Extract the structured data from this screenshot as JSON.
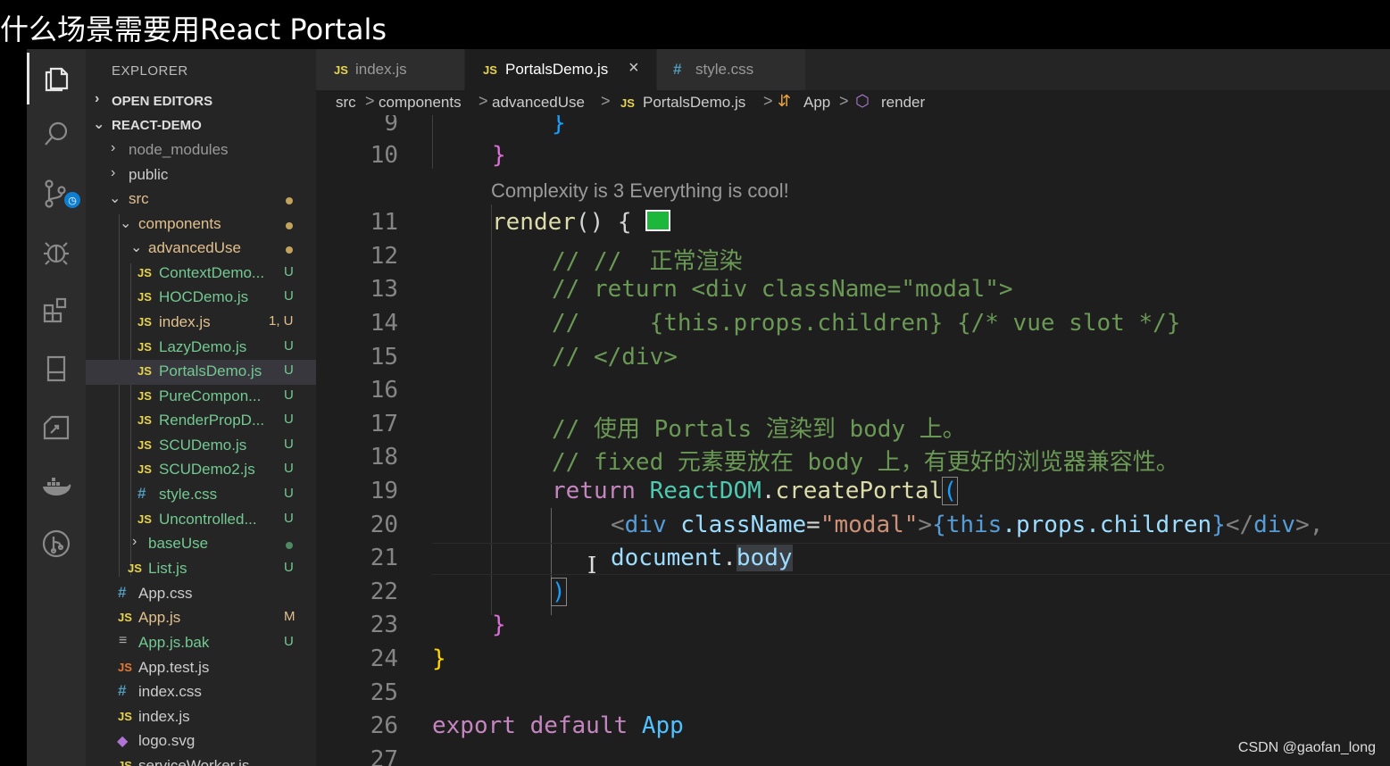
{
  "page_title": "什么场景需要用React Portals",
  "watermark": "CSDN @gaofan_long",
  "activity_bar": {
    "icons": [
      "explorer-icon",
      "search-icon",
      "source-control-icon",
      "debug-icon",
      "extensions-icon",
      "bookmark-icon",
      "remote-explorer-icon",
      "docker-icon",
      "git-graph-icon"
    ],
    "colors": {
      "background": "#2c2c2c",
      "badge": "#0e7ed3"
    }
  },
  "explorer": {
    "title": "EXPLORER",
    "sections": {
      "open_editors": "OPEN EDITORS",
      "project": "REACT-DEMO"
    },
    "items": [
      {
        "label": "node_modules",
        "type": "folder",
        "status": ""
      },
      {
        "label": "public",
        "type": "folder",
        "status": ""
      },
      {
        "label": "src",
        "type": "folder",
        "status": ""
      },
      {
        "label": "components",
        "type": "folder",
        "status": ""
      },
      {
        "label": "advancedUse",
        "type": "folder",
        "status": ""
      },
      {
        "label": "ContextDemo...",
        "type": "js",
        "status": "U"
      },
      {
        "label": "HOCDemo.js",
        "type": "js",
        "status": "U"
      },
      {
        "label": "index.js",
        "type": "js",
        "status": "1, U"
      },
      {
        "label": "LazyDemo.js",
        "type": "js",
        "status": "U"
      },
      {
        "label": "PortalsDemo.js",
        "type": "js",
        "status": "U"
      },
      {
        "label": "PureCompon...",
        "type": "js",
        "status": "U"
      },
      {
        "label": "RenderPropD...",
        "type": "js",
        "status": "U"
      },
      {
        "label": "SCUDemo.js",
        "type": "js",
        "status": "U"
      },
      {
        "label": "SCUDemo2.js",
        "type": "js",
        "status": "U"
      },
      {
        "label": "style.css",
        "type": "css",
        "status": "U"
      },
      {
        "label": "Uncontrolled...",
        "type": "js",
        "status": "U"
      },
      {
        "label": "baseUse",
        "type": "folder",
        "status": ""
      },
      {
        "label": "List.js",
        "type": "js",
        "status": "U"
      },
      {
        "label": "App.css",
        "type": "css",
        "status": ""
      },
      {
        "label": "App.js",
        "type": "js",
        "status": "M"
      },
      {
        "label": "App.js.bak",
        "type": "txt",
        "status": "U"
      },
      {
        "label": "App.test.js",
        "type": "js",
        "status": ""
      },
      {
        "label": "index.css",
        "type": "css",
        "status": ""
      },
      {
        "label": "index.js",
        "type": "js",
        "status": ""
      },
      {
        "label": "logo.svg",
        "type": "svg",
        "status": ""
      },
      {
        "label": "serviceWorker.js",
        "type": "js",
        "status": ""
      }
    ]
  },
  "tabs": [
    {
      "icon": "JS",
      "label": "index.js",
      "active": false
    },
    {
      "icon": "JS",
      "label": "PortalsDemo.js",
      "active": true,
      "close": "×"
    },
    {
      "icon": "#",
      "label": "style.css",
      "active": false
    }
  ],
  "breadcrumb": {
    "items": [
      "src",
      "components",
      "advancedUse",
      "PortalsDemo.js",
      "App",
      "render"
    ],
    "js_icon": "JS",
    "separator": ">"
  },
  "editor": {
    "codelens": "Complexity is 3 Everything is cool!",
    "line_numbers": [
      "9",
      "10",
      "11",
      "12",
      "13",
      "14",
      "15",
      "16",
      "17",
      "18",
      "19",
      "20",
      "21",
      "22",
      "23",
      "24",
      "25",
      "26",
      "27"
    ],
    "lines": {
      "l9": "}",
      "l10": "}",
      "l11_fn": "render",
      "l11_rest": "() {",
      "l12": "// //  正常渲染",
      "l13": "// return <div className=\"modal\">",
      "l14": "//     {this.props.children} {/* vue slot */}",
      "l15": "// </div>",
      "l17": "// 使用 Portals 渲染到 body 上。",
      "l18": "// fixed 元素要放在 body 上，有更好的浏览器兼容性。",
      "l19_kw": "return",
      "l19_obj": "ReactDOM",
      "l19_dot": ".",
      "l19_fn": "createPortal",
      "l19_paren": "(",
      "l20_open": "<",
      "l20_tag": "div",
      "l20_attr": "className",
      "l20_eq": "=",
      "l20_val": "\"modal\"",
      "l20_gt": ">",
      "l20_lbrace": "{",
      "l20_this": "this",
      "l20_props": ".props.children",
      "l20_rbrace": "}",
      "l20_close_open": "</",
      "l20_close_tag": "div",
      "l20_close_end": ">,",
      "l21_obj": "document",
      "l21_dot": ".",
      "l21_prop": "body",
      "l22": ")",
      "l23": "}",
      "l24": "}",
      "l26_kw": "export default",
      "l26_name": "App"
    },
    "colors": {
      "background": "#1e1e1e",
      "keyword": "#c586c0",
      "comment": "#6a9955",
      "string": "#ce9178",
      "function": "#dcdcaa",
      "variable": "#9cdcfe",
      "color_decorator": "#1db83b"
    }
  }
}
